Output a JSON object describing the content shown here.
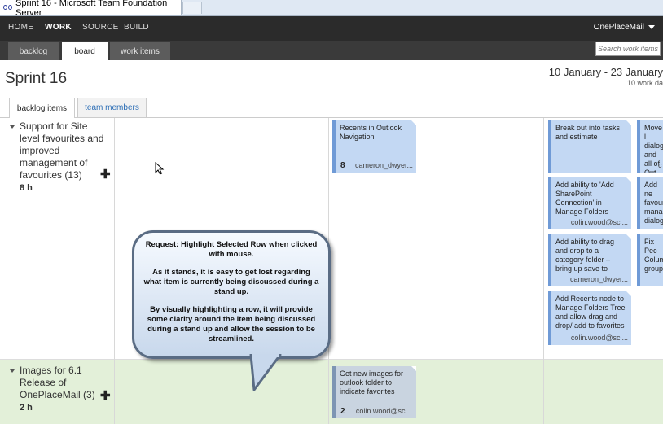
{
  "window": {
    "title": "Sprint 16 - Microsoft Team Foundation Server"
  },
  "topnav": {
    "items": [
      "HOME",
      "WORK",
      "SOURCE",
      "BUILD"
    ],
    "active": "WORK",
    "account": "OnePlaceMail"
  },
  "subnav": {
    "tabs": [
      "backlog",
      "board",
      "work items"
    ],
    "active": "board",
    "search_placeholder": "Search work items ..."
  },
  "sprint": {
    "title": "Sprint 16",
    "dates": "10 January - 23 January",
    "days": "10 work da"
  },
  "page_tabs": {
    "items": [
      "backlog items",
      "team members"
    ],
    "active": "backlog items"
  },
  "backlog": [
    {
      "title": "Support for Site level favourites and improved management of favourites (13)",
      "effort": "8 h"
    },
    {
      "title": "Images for 6.1 Release of OnePlaceMail (3)",
      "effort": "2 h"
    }
  ],
  "cards": {
    "inprogress_row1": {
      "title": "Recents in Outlook Navigation",
      "remaining": "8",
      "owner": "cameron_dwyer..."
    },
    "inprogress_row2": {
      "title": "Get new images for outlook folder to indicate favorites",
      "remaining": "2",
      "owner": "colin.wood@sci..."
    },
    "done1": {
      "title": "Break out into tasks and estimate",
      "owner": ""
    },
    "done2": {
      "title": "Add ability to 'Add SharePoint Connection' in Manage Folders",
      "owner": "colin.wood@sci..."
    },
    "done3": {
      "title": "Add ability to drag and drop to a category folder – bring up save to",
      "owner": "cameron_dwyer..."
    },
    "done4": {
      "title": "Add Recents node to Manage Folders Tree and allow drag and drop/ add to favorites",
      "owner": "colin.wood@sci..."
    },
    "cut1": {
      "title": "Move l dialog and all of Out",
      "owner": "c"
    },
    "cut2": {
      "title": "Add ne favour manag dialog",
      "owner": ""
    },
    "cut3": {
      "title": "Fix Pec Colum group",
      "owner": ""
    }
  },
  "callout": {
    "paragraphs": [
      "Request: Highlight Selected Row when clicked with mouse.",
      "As it stands, it is easy to get lost regarding what item is currently being discussed during a stand up.",
      "By visually highlighting a row, it will provide some clarity around the item being discussed during a stand up and allow the session to be streamlined."
    ]
  },
  "colors": {
    "row_highlight": "#e3f0d9",
    "card": "#c3d8f3",
    "card_border": "#6f9ad6",
    "topnav": "#2b2b2b"
  }
}
